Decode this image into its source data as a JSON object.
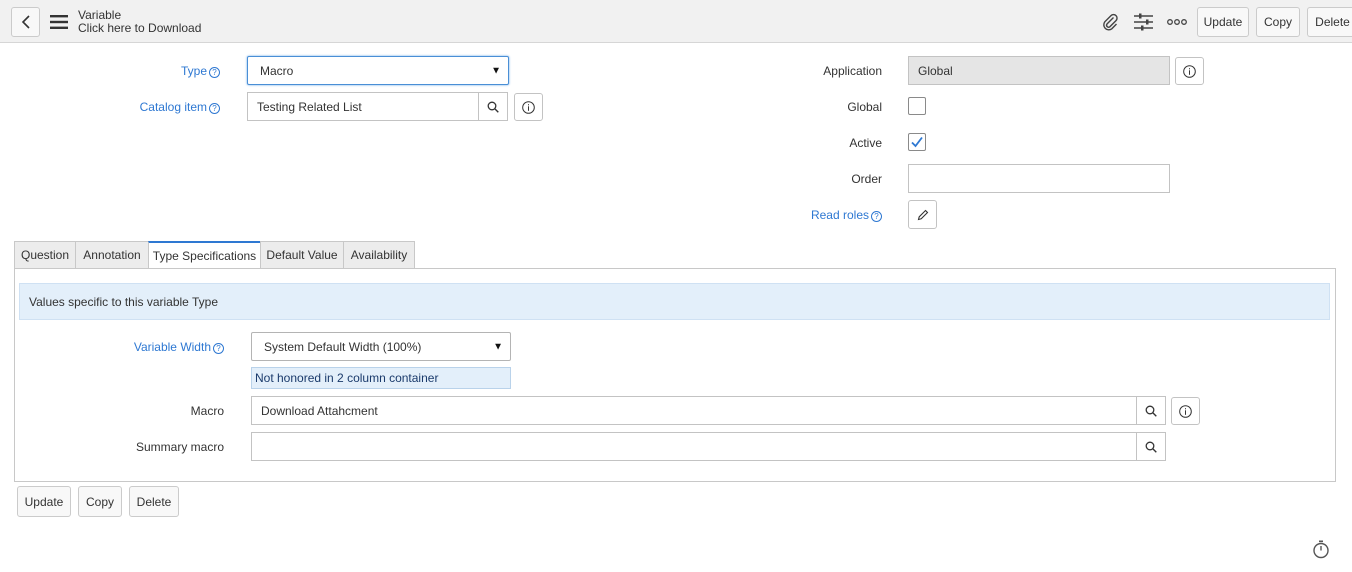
{
  "header": {
    "title": "Variable",
    "subtitle": "Click here to Download",
    "buttons": {
      "update": "Update",
      "copy": "Copy",
      "delete": "Delete"
    },
    "icons": [
      "back-icon",
      "hamburger-menu-icon",
      "paperclip-icon",
      "sliders-icon",
      "more-icon"
    ]
  },
  "form": {
    "type": {
      "label": "Type",
      "value": "Macro"
    },
    "catalog_item": {
      "label": "Catalog item",
      "value": "Testing Related List"
    },
    "application": {
      "label": "Application",
      "value": "Global"
    },
    "global": {
      "label": "Global",
      "checked": false
    },
    "active": {
      "label": "Active",
      "checked": true
    },
    "order": {
      "label": "Order",
      "value": ""
    },
    "read_roles": {
      "label": "Read roles"
    }
  },
  "tabs": [
    {
      "label": "Question"
    },
    {
      "label": "Annotation"
    },
    {
      "label": "Type Specifications",
      "active": true
    },
    {
      "label": "Default Value"
    },
    {
      "label": "Availability"
    }
  ],
  "type_specs": {
    "info": "Values specific to this variable Type",
    "variable_width": {
      "label": "Variable Width",
      "value": "System Default Width (100%)",
      "note": "Not honored in 2 column container"
    },
    "macro": {
      "label": "Macro",
      "value": "Download Attahcment"
    },
    "summary_macro": {
      "label": "Summary macro",
      "value": ""
    }
  },
  "footer": {
    "update": "Update",
    "copy": "Copy",
    "delete": "Delete"
  },
  "colors": {
    "link": "#2e78d2",
    "info_bg": "#e3effa",
    "header_bg": "#f1f1f1"
  }
}
